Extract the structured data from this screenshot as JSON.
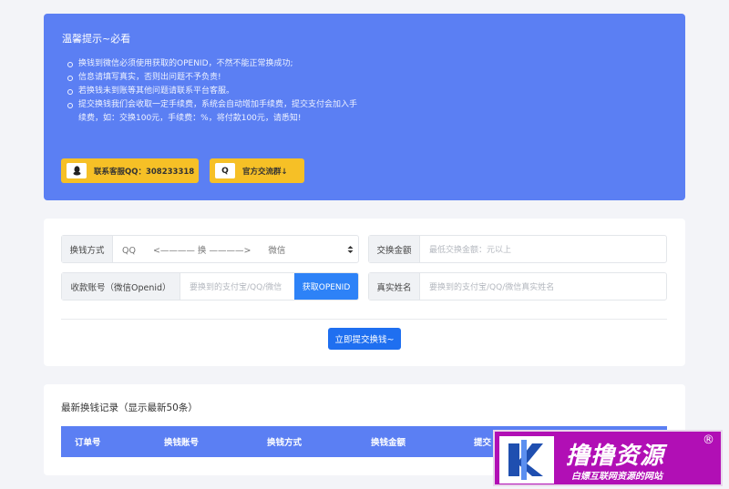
{
  "notice": {
    "title": "温馨提示~必看",
    "items": [
      "换钱到微信必须使用获取的OPENID，不然不能正常换成功;",
      "信息请填写真实，否则出问题不予负责!",
      "若换钱未到账等其他问题请联系平台客服。",
      "提交换钱我们会收取一定手续费，系统会自动增加手续费，提交支付会加入手续费，如：交换100元，手续费：%，将付款100元，请悉知!"
    ],
    "qq_button": {
      "icon": "qq-icon",
      "label": "联系客服QQ：308233318"
    },
    "group_button": {
      "icon": "qq-group-icon",
      "icon_text": "Q",
      "label": "官方交流群↓"
    }
  },
  "form": {
    "method": {
      "label": "换钱方式",
      "value": "QQ　　<———— 换 ————>　　微信"
    },
    "amount": {
      "label": "交换金额",
      "placeholder": "最低交换金额：元以上"
    },
    "account": {
      "label": "收款账号（微信Openid）",
      "placeholder": "要换到的支付宝/QQ/微信",
      "button": "获取OPENID"
    },
    "name": {
      "label": "真实姓名",
      "placeholder": "要换到的支付宝/QQ/微信真实姓名"
    },
    "submit": "立即提交换钱~"
  },
  "records": {
    "title": "最新换钱记录（显示最新50条）",
    "columns": [
      "订单号",
      "换钱账号",
      "换钱方式",
      "换钱金额",
      "提交"
    ]
  },
  "watermark": {
    "title": "撸撸资源",
    "reg": "®",
    "subtitle": "白嫖互联网资源的网站"
  },
  "colors": {
    "primary": "#5b7ff3",
    "button_blue": "#2d82f7",
    "yellow": "#f6c026",
    "watermark_bg": "#b10fb5"
  }
}
